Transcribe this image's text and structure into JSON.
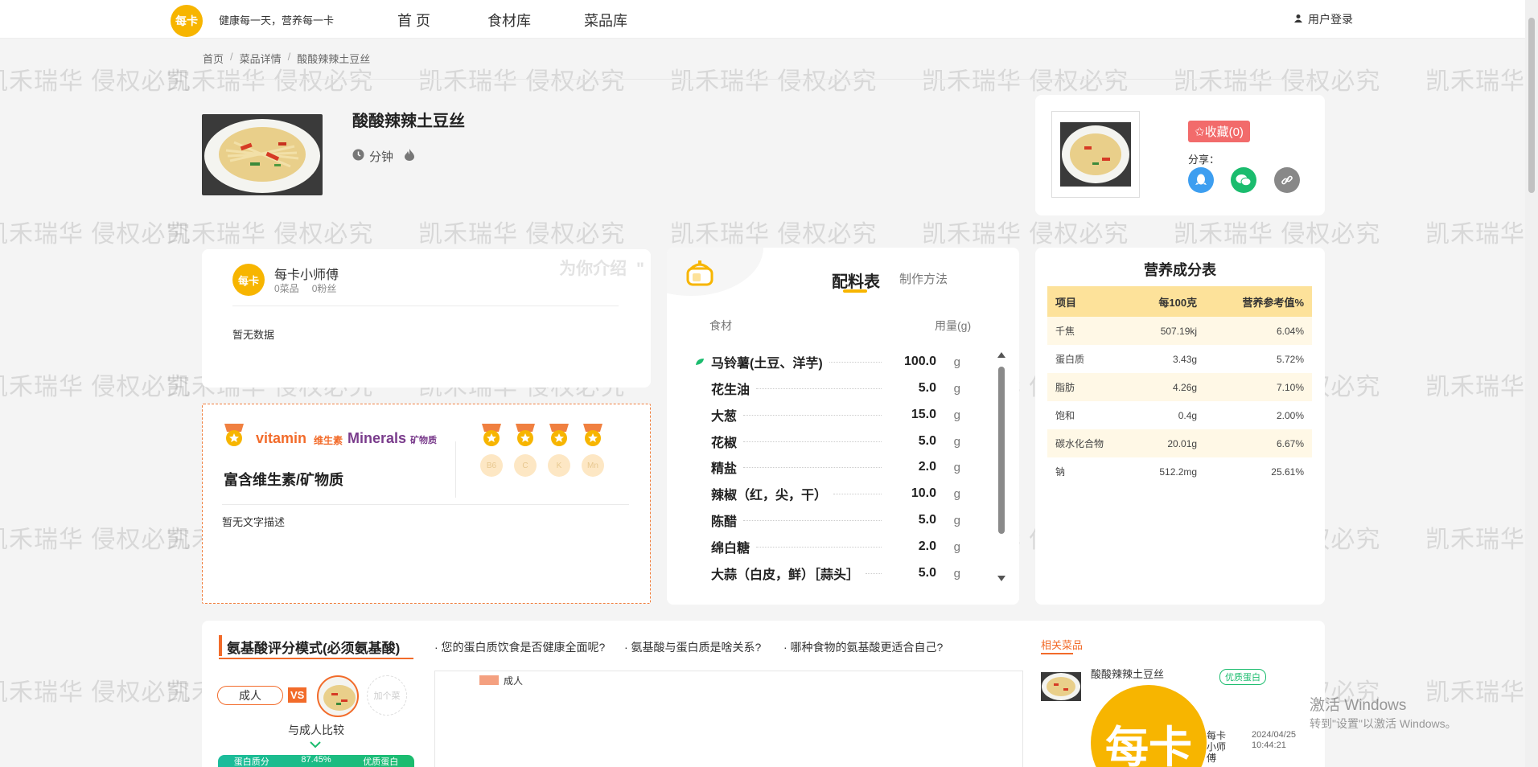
{
  "topbar": {
    "logo_text": "每卡",
    "slogan": "健康每一天，营养每一卡",
    "nav": [
      "首 页",
      "食材库",
      "菜品库"
    ],
    "login": "用户登录"
  },
  "breadcrumb": [
    "首页",
    "菜品详情",
    "酸酸辣辣土豆丝"
  ],
  "dish": {
    "title": "酸酸辣辣土豆丝",
    "time_label": "分钟"
  },
  "favorite": {
    "button": "✩收藏(0)",
    "share_label": "分享："
  },
  "author": {
    "name": "每卡小师傅",
    "dishes": "0菜品",
    "fans": "0粉丝",
    "intro_label": "为你介绍",
    "quote": "\"",
    "no_data": "暂无数据"
  },
  "vitamin": {
    "vitamin_en": "vitamin",
    "vitamin_cn": "维生素",
    "minerals_en": "Minerals",
    "minerals_cn": "矿物质",
    "title": "富含维生素/矿物质",
    "nutrients": [
      "B6",
      "C",
      "K",
      "Mn"
    ],
    "desc": "暂无文字描述"
  },
  "ingredients": {
    "tab_active": "配料表",
    "tab_other": "制作方法",
    "col_name": "食材",
    "col_amount": "用量(g)",
    "rows": [
      {
        "name": "马铃薯(土豆、洋芋)",
        "amount": "100.0",
        "unit": "g"
      },
      {
        "name": "花生油",
        "amount": "5.0",
        "unit": "g"
      },
      {
        "name": "大葱",
        "amount": "15.0",
        "unit": "g"
      },
      {
        "name": "花椒",
        "amount": "5.0",
        "unit": "g"
      },
      {
        "name": "精盐",
        "amount": "2.0",
        "unit": "g"
      },
      {
        "name": "辣椒（红，尖，干）",
        "amount": "10.0",
        "unit": "g"
      },
      {
        "name": "陈醋",
        "amount": "5.0",
        "unit": "g"
      },
      {
        "name": "绵白糖",
        "amount": "2.0",
        "unit": "g"
      },
      {
        "name": "大蒜（白皮，鲜）［蒜头］",
        "amount": "5.0",
        "unit": "g"
      }
    ]
  },
  "nutrition": {
    "title": "营养成分表",
    "headers": [
      "项目",
      "每100克",
      "营养参考值%"
    ],
    "rows": [
      [
        "千焦",
        "507.19kj",
        "6.04%"
      ],
      [
        "蛋白质",
        "3.43g",
        "5.72%"
      ],
      [
        "脂肪",
        "4.26g",
        "7.10%"
      ],
      [
        "饱和",
        "0.4g",
        "2.00%"
      ],
      [
        "碳水化合物",
        "20.01g",
        "6.67%"
      ],
      [
        "钠",
        "512.2mg",
        "25.61%"
      ]
    ]
  },
  "amino": {
    "title": "氨基酸评分模式(必须氨基酸)",
    "questions": [
      "· 您的蛋白质饮食是否健康全面呢?",
      "· 氨基酸与蛋白质是啥关系?",
      "· 哪种食物的氨基酸更适合自己?"
    ],
    "adult": "成人",
    "vs": "VS",
    "add": "加个菜",
    "compare": "与成人比较",
    "panel_label": "成人",
    "bottom_left": "蛋白质分",
    "bottom_mid": "87.45%",
    "bottom_right": "优质蛋白"
  },
  "related": {
    "label": "相关菜品",
    "item_title": "酸酸辣辣土豆丝",
    "badge": "优质蛋白",
    "author": "每卡小师傅",
    "date": "2024/04/25",
    "time": "10:44:21"
  },
  "watermark": "凯禾瑞华 侵权必究",
  "windows": {
    "line1": "激活 Windows",
    "line2": "转到\"设置\"以激活 Windows。"
  },
  "colors": {
    "brand": "#f7b500",
    "accent": "#f26b2a",
    "vitamin": "#f26b2a",
    "minerals": "#7a3c8c"
  }
}
